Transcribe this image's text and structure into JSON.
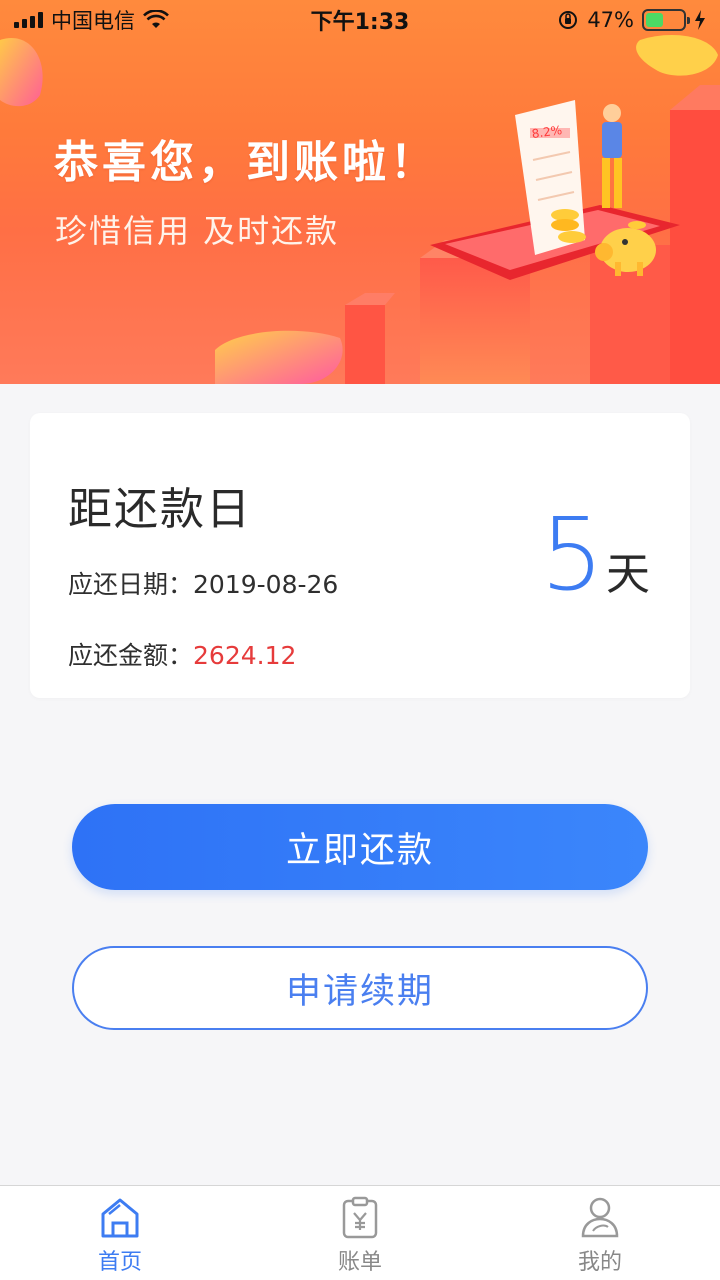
{
  "status_bar": {
    "carrier": "中国电信",
    "time": "下午1:33",
    "battery_percent": "47%",
    "battery_level": 0.47
  },
  "banner": {
    "title": "恭喜您，到账啦！",
    "subtitle": "珍惜信用 及时还款",
    "receipt_text": "8.2%"
  },
  "repayment": {
    "title": "距还款日",
    "due_date_label": "应还日期：",
    "due_date": "2019-08-26",
    "amount_label": "应还金额：",
    "amount": "2624.12",
    "days_left": "5",
    "days_unit": "天"
  },
  "actions": {
    "repay_now": "立即还款",
    "apply_extension": "申请续期"
  },
  "tabs": [
    {
      "label": "首页",
      "icon": "home-icon",
      "active": true
    },
    {
      "label": "账单",
      "icon": "bill-icon",
      "active": false
    },
    {
      "label": "我的",
      "icon": "profile-icon",
      "active": false
    }
  ],
  "colors": {
    "accent": "#3d7cf2",
    "amount_red": "#e63b3b",
    "banner_orange": "#ff7a3b"
  }
}
